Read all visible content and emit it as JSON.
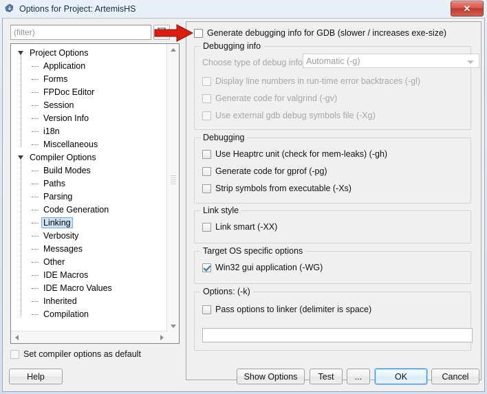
{
  "window": {
    "title": "Options for Project: ArtemisHS",
    "icon": "lazarus-icon",
    "close_label": "✕"
  },
  "sidebar": {
    "filter": {
      "value": "",
      "placeholder": "(filter)"
    },
    "clear_filter_icon": "filter-clear-icon",
    "tree": [
      {
        "label": "Project Options",
        "level": 0,
        "expanded": true,
        "selected": false
      },
      {
        "label": "Application",
        "level": 1,
        "expanded": false,
        "selected": false
      },
      {
        "label": "Forms",
        "level": 1,
        "expanded": false,
        "selected": false
      },
      {
        "label": "FPDoc Editor",
        "level": 1,
        "expanded": false,
        "selected": false
      },
      {
        "label": "Session",
        "level": 1,
        "expanded": false,
        "selected": false
      },
      {
        "label": "Version Info",
        "level": 1,
        "expanded": false,
        "selected": false
      },
      {
        "label": "i18n",
        "level": 1,
        "expanded": false,
        "selected": false
      },
      {
        "label": "Miscellaneous",
        "level": 1,
        "expanded": false,
        "selected": false
      },
      {
        "label": "Compiler Options",
        "level": 0,
        "expanded": true,
        "selected": false
      },
      {
        "label": "Build Modes",
        "level": 1,
        "expanded": false,
        "selected": false
      },
      {
        "label": "Paths",
        "level": 1,
        "expanded": false,
        "selected": false
      },
      {
        "label": "Parsing",
        "level": 1,
        "expanded": false,
        "selected": false
      },
      {
        "label": "Code Generation",
        "level": 1,
        "expanded": false,
        "selected": false
      },
      {
        "label": "Linking",
        "level": 1,
        "expanded": false,
        "selected": true
      },
      {
        "label": "Verbosity",
        "level": 1,
        "expanded": false,
        "selected": false
      },
      {
        "label": "Messages",
        "level": 1,
        "expanded": false,
        "selected": false
      },
      {
        "label": "Other",
        "level": 1,
        "expanded": false,
        "selected": false
      },
      {
        "label": "IDE Macros",
        "level": 1,
        "expanded": false,
        "selected": false
      },
      {
        "label": "IDE Macro Values",
        "level": 1,
        "expanded": false,
        "selected": false
      },
      {
        "label": "Inherited",
        "level": 1,
        "expanded": false,
        "selected": false
      },
      {
        "label": "Compilation",
        "level": 1,
        "expanded": false,
        "selected": false
      }
    ],
    "set_default": {
      "label": "Set compiler options as default",
      "checked": false
    }
  },
  "main": {
    "generate_debug_gdb": {
      "label": "Generate debugging info for GDB (slower / increases exe-size)",
      "checked": false,
      "enabled": true
    },
    "debugging_info_group": {
      "title": "Debugging info",
      "enabled": false,
      "combo_label": "Choose type of debug info",
      "combo_value": "Automatic (-g)",
      "options": [
        {
          "label": "Display line numbers in run-time error backtraces (-gl)",
          "checked": false
        },
        {
          "label": "Generate code for valgrind (-gv)",
          "checked": false
        },
        {
          "label": "Use external gdb debug symbols file (-Xg)",
          "checked": false
        }
      ]
    },
    "debugging_group": {
      "title": "Debugging",
      "options": [
        {
          "label": "Use Heaptrc unit (check for mem-leaks) (-gh)",
          "checked": false
        },
        {
          "label": "Generate code for gprof (-pg)",
          "checked": false
        },
        {
          "label": "Strip symbols from executable (-Xs)",
          "checked": false
        }
      ]
    },
    "link_style_group": {
      "title": "Link style",
      "options": [
        {
          "label": "Link smart (-XX)",
          "checked": false
        }
      ]
    },
    "target_os_group": {
      "title": "Target OS specific options",
      "options": [
        {
          "label": "Win32 gui application (-WG)",
          "checked": true
        }
      ]
    },
    "options_group": {
      "title": "Options:  (-k)",
      "pass_options": {
        "label": "Pass options to linker (delimiter is space)",
        "checked": false
      },
      "field_value": "",
      "field_placeholder": ""
    }
  },
  "footer": {
    "help": "Help",
    "show_options": "Show Options",
    "test": "Test",
    "ellipsis": "...",
    "ok": "OK",
    "cancel": "Cancel"
  },
  "annotation": {
    "arrow_color": "#d81f12",
    "arrow_target": "generate-debug-gdb-checkbox"
  }
}
